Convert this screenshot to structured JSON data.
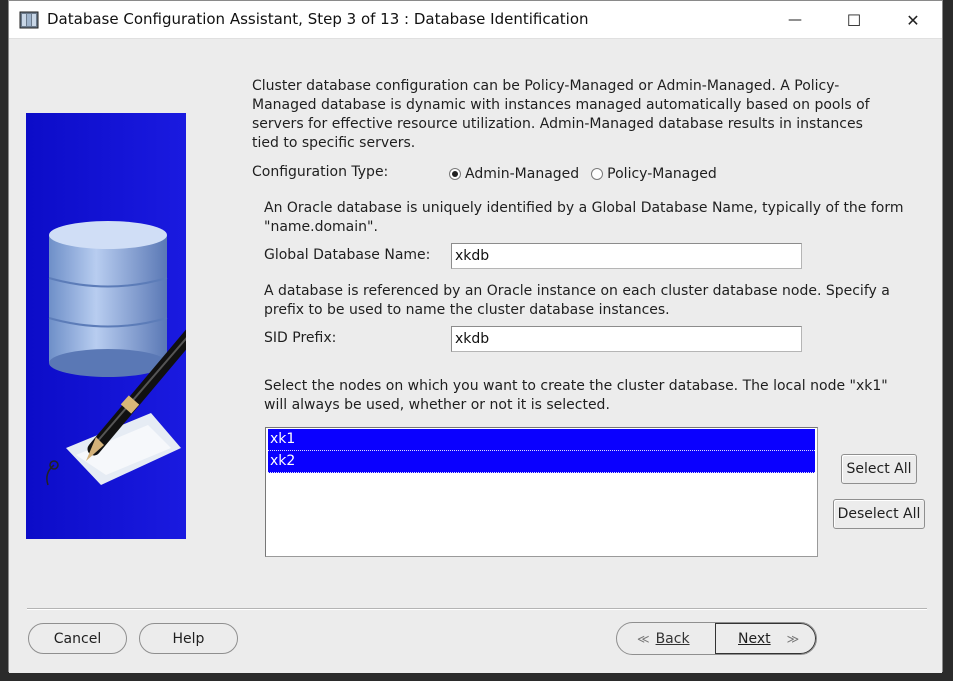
{
  "window": {
    "title": "Database Configuration Assistant, Step 3 of 13 : Database Identification",
    "minimize_glyph": "—",
    "maximize_glyph": "☐",
    "close_glyph": "✕"
  },
  "intro_text": [
    "Cluster database configuration can be Policy-Managed or Admin-Managed. A Policy-",
    "Managed database is dynamic with instances managed automatically based on pools of",
    "servers for effective resource utilization. Admin-Managed database results in instances",
    "tied to specific servers."
  ],
  "configuration": {
    "label": "Configuration Type:",
    "options": [
      {
        "label": "Admin-Managed",
        "selected": true
      },
      {
        "label": "Policy-Managed",
        "selected": false
      }
    ]
  },
  "global_db": {
    "description": [
      "An Oracle database is uniquely identified by a Global Database Name, typically of the form",
      "\"name.domain\"."
    ],
    "label": "Global Database Name:",
    "value": "xkdb"
  },
  "sid": {
    "description": [
      "A database is referenced by an Oracle instance on each cluster database node. Specify a",
      "prefix to be used to name the cluster database instances."
    ],
    "label": "SID Prefix:",
    "value": "xkdb"
  },
  "nodes": {
    "description": [
      "Select the nodes on which you want to create the cluster database. The local node \"xk1\"",
      "will always be used, whether or not it is selected."
    ],
    "items": [
      {
        "label": "xk1",
        "selected": true
      },
      {
        "label": "xk2",
        "selected": true
      }
    ],
    "select_all": "Select All",
    "deselect_all": "Deselect All"
  },
  "footer": {
    "cancel": "Cancel",
    "help": "Help",
    "back": "Back",
    "next": "Next"
  },
  "colors": {
    "selection": "#0a00ff",
    "side_panel": "#1010d8"
  }
}
